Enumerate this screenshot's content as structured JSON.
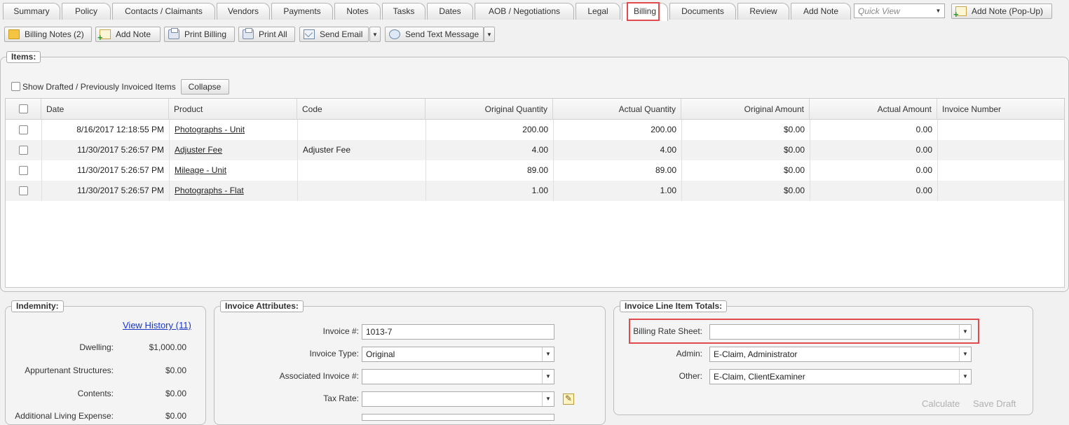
{
  "tabs": [
    {
      "label": "Summary",
      "active": false
    },
    {
      "label": "Policy",
      "active": false
    },
    {
      "label": "Contacts / Claimants",
      "active": false
    },
    {
      "label": "Vendors",
      "active": false
    },
    {
      "label": "Payments",
      "active": false
    },
    {
      "label": "Notes",
      "active": false
    },
    {
      "label": "Tasks",
      "active": false
    },
    {
      "label": "Dates",
      "active": false
    },
    {
      "label": "AOB / Negotiations",
      "active": false
    },
    {
      "label": "Legal",
      "active": false
    },
    {
      "label": "Billing",
      "active": true
    },
    {
      "label": "Documents",
      "active": false
    },
    {
      "label": "Review",
      "active": false
    },
    {
      "label": "Add Note",
      "active": false
    }
  ],
  "quick_view": {
    "placeholder": "Quick View"
  },
  "add_note_popup_label": "Add Note (Pop-Up)",
  "toolbar": {
    "billing_notes": "Billing Notes (2)",
    "add_note": "Add Note",
    "print_billing": "Print Billing",
    "print_all": "Print All",
    "send_email": "Send Email",
    "send_text": "Send Text Message"
  },
  "items_panel": {
    "legend": "Items:",
    "show_drafted_label": "Show Drafted / Previously Invoiced Items",
    "collapse_label": "Collapse",
    "columns": [
      "Date",
      "Product",
      "Code",
      "Original Quantity",
      "Actual Quantity",
      "Original Amount",
      "Actual Amount",
      "Invoice Number"
    ],
    "rows": [
      {
        "date": "8/16/2017 12:18:55 PM",
        "product": "Photographs - Unit",
        "code": "",
        "orig_qty": "200.00",
        "actual_qty": "200.00",
        "orig_amount": "$0.00",
        "actual_amount": "0.00",
        "invoice_number": ""
      },
      {
        "date": "11/30/2017 5:26:57 PM",
        "product": "Adjuster Fee",
        "code": "Adjuster Fee",
        "orig_qty": "4.00",
        "actual_qty": "4.00",
        "orig_amount": "$0.00",
        "actual_amount": "0.00",
        "invoice_number": ""
      },
      {
        "date": "11/30/2017 5:26:57 PM",
        "product": "Mileage - Unit",
        "code": "",
        "orig_qty": "89.00",
        "actual_qty": "89.00",
        "orig_amount": "$0.00",
        "actual_amount": "0.00",
        "invoice_number": ""
      },
      {
        "date": "11/30/2017 5:26:57 PM",
        "product": "Photographs - Flat",
        "code": "",
        "orig_qty": "1.00",
        "actual_qty": "1.00",
        "orig_amount": "$0.00",
        "actual_amount": "0.00",
        "invoice_number": ""
      }
    ]
  },
  "indemnity": {
    "legend": "Indemnity:",
    "view_history": "View History (11)",
    "rows": [
      {
        "label": "Dwelling:",
        "value": "$1,000.00"
      },
      {
        "label": "Appurtenant Structures:",
        "value": "$0.00"
      },
      {
        "label": "Contents:",
        "value": "$0.00"
      },
      {
        "label": "Additional Living Expense:",
        "value": "$0.00"
      }
    ]
  },
  "invoice_attributes": {
    "legend": "Invoice Attributes:",
    "invoice_no_label": "Invoice #:",
    "invoice_no_value": "1013-7",
    "invoice_type_label": "Invoice Type:",
    "invoice_type_value": "Original",
    "associated_label": "Associated Invoice #:",
    "associated_value": "",
    "tax_rate_label": "Tax Rate:",
    "tax_rate_value": ""
  },
  "line_item_totals": {
    "legend": "Invoice Line Item Totals:",
    "billing_rate_label": "Billing Rate Sheet:",
    "billing_rate_value": "",
    "admin_label": "Admin:",
    "admin_value": "E-Claim, Administrator",
    "other_label": "Other:",
    "other_value": "E-Claim, ClientExaminer",
    "calculate_label": "Calculate",
    "save_draft_label": "Save Draft"
  },
  "colors": {
    "highlight": "#e24b4b",
    "link": "#1a36c8"
  }
}
